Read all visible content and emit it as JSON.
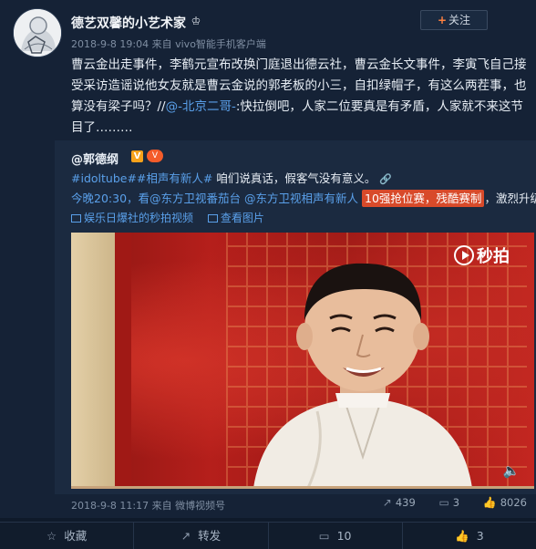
{
  "post": {
    "username": "德艺双馨的小艺术家",
    "follow_label": "关注",
    "meta": "2018-9-8 19:04 来自 vivo智能手机客户端",
    "text_part1": "曹云金出走事件，李鹤元宣布改换门庭退出德云社，曹云金长文事件，李寅飞自己接受采访造谣说他女友就是曹云金说的郭老板的小三，自扣绿帽子，有这么两茬事，也算没有梁子吗？//",
    "mention": "@-北京二哥-",
    "text_part2": ":快拉倒吧，人家二位要真是有矛盾，人家就不来这节目了………"
  },
  "repost": {
    "author": "@郭德纲",
    "v_badge": "V",
    "vip_badge": "V",
    "hashtags": "#idoltube##相声有新人#",
    "line1_text": " 咱们说真话，假客气没有意义。",
    "line2_prefix": "今晚20:30，看",
    "line2_mention1": "@东方卫视番茄台",
    "line2_mention2": "@东方卫视相声有新人",
    "line2_highlight": "10强抢位赛，残酷赛制",
    "line2_suffix": "，激烈升级！",
    "video_link": "娱乐日爆社的秒拍视频",
    "image_link": "查看图片",
    "watermark": "秒拍",
    "meta": "2018-9-8 11:17 来自 微博视频号",
    "stats": {
      "reposts": "439",
      "comments": "3",
      "likes": "8026"
    },
    "video_progress": 1.0
  },
  "actions": {
    "favorite": "收藏",
    "forward": "转发",
    "comment": "10",
    "like": "3"
  },
  "icons": {
    "crown": "crown-icon",
    "link": "link-icon",
    "video": "video-icon",
    "image": "image-icon",
    "volume": "volume-icon"
  },
  "colors": {
    "background": "#0f1a2a",
    "card": "#152236",
    "link": "#5aa0ea",
    "highlight": "#d84a2a",
    "follow_plus": "#ff8140"
  }
}
